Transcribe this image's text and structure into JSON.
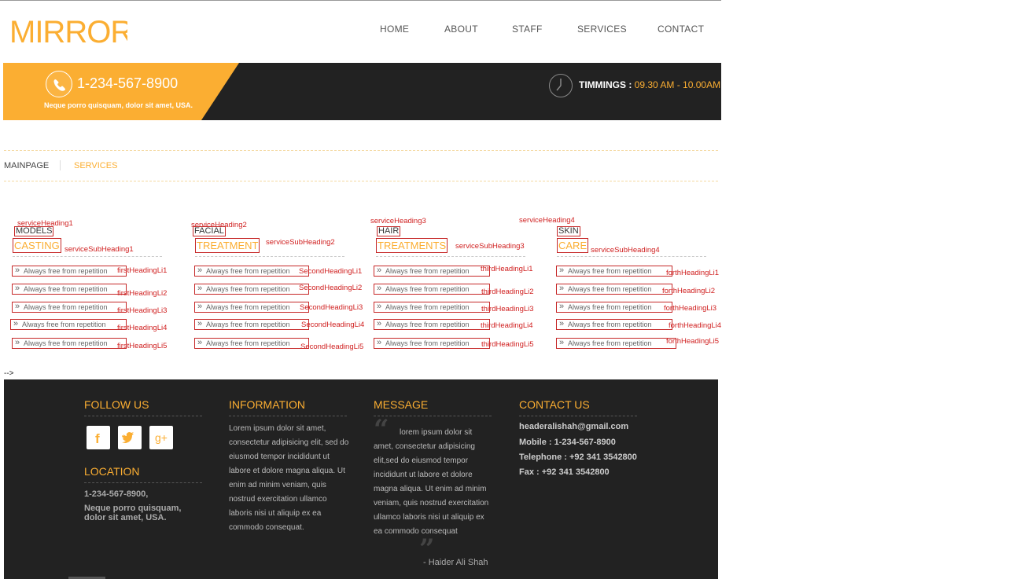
{
  "brand": {
    "logo_text": "MIRROR",
    "accent": "#fbae32",
    "dark": "#222222"
  },
  "nav": {
    "items": [
      "HOME",
      "ABOUT",
      "STAFF",
      "SERVICES",
      "CONTACT"
    ]
  },
  "banner": {
    "phone": "1-234-567-8900",
    "address": "Neque porro quisquam, dolor sit amet, USA.",
    "timings_label": "TIMMINGS :",
    "timings_value": "09.30 AM - 10.00AM"
  },
  "breadcrumb": {
    "home": "MAINPAGE",
    "current": "SERVICES"
  },
  "services": {
    "columns": [
      {
        "heading_tag": "serviceHeading1",
        "heading": "MODELS",
        "sub": "CASTING",
        "sub_tag": "serviceSubHeading1",
        "items": [
          "Always free from repetition",
          "Always free from repetition",
          "Always free from repetition",
          "Always free from repetition",
          "Always free from repetition"
        ],
        "item_tags": [
          "firstHeadingLi1",
          "firstHeadingLi2",
          "firstHeadingLi3",
          "firstHeadingLi4",
          "firstHeadingLi5"
        ]
      },
      {
        "heading_tag": "serviceHeading2",
        "heading": "FACIAL",
        "sub": "TREATMENT",
        "sub_tag": "serviceSubHeading2",
        "items": [
          "Always free from repetition",
          "Always free from repetition",
          "Always free from repetition",
          "Always free from repetition",
          "Always free from repetition"
        ],
        "item_tags": [
          "SecondHeadingLi1",
          "SecondHeadingLi2",
          "SecondHeadingLi3",
          "SecondHeadingLi4",
          "SecondHeadingLi5"
        ]
      },
      {
        "heading_tag": "serviceHeading3",
        "heading": "HAIR",
        "sub": "TREATMENTS",
        "sub_tag": "serviceSubHeading3",
        "items": [
          "Always free from repetition",
          "Always free from repetition",
          "Always free from repetition",
          "Always free from repetition",
          "Always free from repetition"
        ],
        "item_tags": [
          "thirdHeadingLi1",
          "thirdHeadingLi2",
          "thirdHeadingLi3",
          "thirdHeadingLi4",
          "thirdHeadingLi5"
        ]
      },
      {
        "heading_tag": "serviceHeading4",
        "heading": "SKIN",
        "sub": "CARE",
        "sub_tag": "serviceSubHeading4",
        "items": [
          "Always free from repetition",
          "Always free from repetition",
          "Always free from repetition",
          "Always free from repetition",
          "Always free from repetition"
        ],
        "item_tags": [
          "forthHeadingLi1",
          "forthHeadingLi2",
          "forthHeadingLi3",
          "forthHeadingLi4",
          "forthHeadingLi5"
        ]
      }
    ]
  },
  "stray_text": "-->",
  "footer": {
    "follow_title": "FOLLOW US",
    "social": [
      "facebook-icon",
      "twitter-icon",
      "google-plus-icon"
    ],
    "location_title": "LOCATION",
    "location_phone": "1-234-567-8900,",
    "location_address": "Neque porro quisquam, dolor sit amet, USA.",
    "info_title": "INFORMATION",
    "info_text": "Lorem ipsum dolor sit amet, consectetur adipisicing elit, sed do eiusmod tempor incididunt ut labore et dolore magna aliqua. Ut enim ad minim veniam, quis nostrud exercitation ullamco laboris nisi ut aliquip ex ea commodo consequat.",
    "message_title": "MESSAGE",
    "message_text": "lorem ipsum dolor sit amet, consectetur adipisicing elit,sed do eiusmod tempor incididunt ut labore et dolore magna aliqua. Ut enim ad minim veniam, quis nostrud exercitation ullamco laboris nisi ut aliquip ex ea commodo consequat",
    "message_author": "- Haider Ali Shah",
    "contact_title": "CONTACT US",
    "contact_email": "headeralishah@gmail.com",
    "contact_mobile": "Mobile : 1-234-567-8900",
    "contact_telephone": "Telephone : +92 341 3542800",
    "contact_fax": "Fax : +92 341 3542800"
  }
}
